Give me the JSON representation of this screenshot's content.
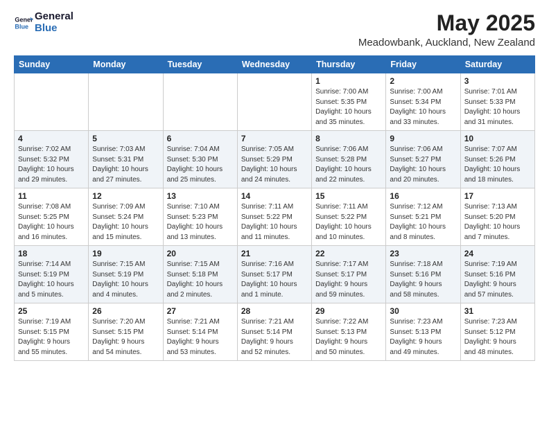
{
  "header": {
    "logo_line1": "General",
    "logo_line2": "Blue",
    "month_title": "May 2025",
    "location": "Meadowbank, Auckland, New Zealand"
  },
  "weekdays": [
    "Sunday",
    "Monday",
    "Tuesday",
    "Wednesday",
    "Thursday",
    "Friday",
    "Saturday"
  ],
  "weeks": [
    [
      {
        "day": "",
        "content": ""
      },
      {
        "day": "",
        "content": ""
      },
      {
        "day": "",
        "content": ""
      },
      {
        "day": "",
        "content": ""
      },
      {
        "day": "1",
        "content": "Sunrise: 7:00 AM\nSunset: 5:35 PM\nDaylight: 10 hours\nand 35 minutes."
      },
      {
        "day": "2",
        "content": "Sunrise: 7:00 AM\nSunset: 5:34 PM\nDaylight: 10 hours\nand 33 minutes."
      },
      {
        "day": "3",
        "content": "Sunrise: 7:01 AM\nSunset: 5:33 PM\nDaylight: 10 hours\nand 31 minutes."
      }
    ],
    [
      {
        "day": "4",
        "content": "Sunrise: 7:02 AM\nSunset: 5:32 PM\nDaylight: 10 hours\nand 29 minutes."
      },
      {
        "day": "5",
        "content": "Sunrise: 7:03 AM\nSunset: 5:31 PM\nDaylight: 10 hours\nand 27 minutes."
      },
      {
        "day": "6",
        "content": "Sunrise: 7:04 AM\nSunset: 5:30 PM\nDaylight: 10 hours\nand 25 minutes."
      },
      {
        "day": "7",
        "content": "Sunrise: 7:05 AM\nSunset: 5:29 PM\nDaylight: 10 hours\nand 24 minutes."
      },
      {
        "day": "8",
        "content": "Sunrise: 7:06 AM\nSunset: 5:28 PM\nDaylight: 10 hours\nand 22 minutes."
      },
      {
        "day": "9",
        "content": "Sunrise: 7:06 AM\nSunset: 5:27 PM\nDaylight: 10 hours\nand 20 minutes."
      },
      {
        "day": "10",
        "content": "Sunrise: 7:07 AM\nSunset: 5:26 PM\nDaylight: 10 hours\nand 18 minutes."
      }
    ],
    [
      {
        "day": "11",
        "content": "Sunrise: 7:08 AM\nSunset: 5:25 PM\nDaylight: 10 hours\nand 16 minutes."
      },
      {
        "day": "12",
        "content": "Sunrise: 7:09 AM\nSunset: 5:24 PM\nDaylight: 10 hours\nand 15 minutes."
      },
      {
        "day": "13",
        "content": "Sunrise: 7:10 AM\nSunset: 5:23 PM\nDaylight: 10 hours\nand 13 minutes."
      },
      {
        "day": "14",
        "content": "Sunrise: 7:11 AM\nSunset: 5:22 PM\nDaylight: 10 hours\nand 11 minutes."
      },
      {
        "day": "15",
        "content": "Sunrise: 7:11 AM\nSunset: 5:22 PM\nDaylight: 10 hours\nand 10 minutes."
      },
      {
        "day": "16",
        "content": "Sunrise: 7:12 AM\nSunset: 5:21 PM\nDaylight: 10 hours\nand 8 minutes."
      },
      {
        "day": "17",
        "content": "Sunrise: 7:13 AM\nSunset: 5:20 PM\nDaylight: 10 hours\nand 7 minutes."
      }
    ],
    [
      {
        "day": "18",
        "content": "Sunrise: 7:14 AM\nSunset: 5:19 PM\nDaylight: 10 hours\nand 5 minutes."
      },
      {
        "day": "19",
        "content": "Sunrise: 7:15 AM\nSunset: 5:19 PM\nDaylight: 10 hours\nand 4 minutes."
      },
      {
        "day": "20",
        "content": "Sunrise: 7:15 AM\nSunset: 5:18 PM\nDaylight: 10 hours\nand 2 minutes."
      },
      {
        "day": "21",
        "content": "Sunrise: 7:16 AM\nSunset: 5:17 PM\nDaylight: 10 hours\nand 1 minute."
      },
      {
        "day": "22",
        "content": "Sunrise: 7:17 AM\nSunset: 5:17 PM\nDaylight: 9 hours\nand 59 minutes."
      },
      {
        "day": "23",
        "content": "Sunrise: 7:18 AM\nSunset: 5:16 PM\nDaylight: 9 hours\nand 58 minutes."
      },
      {
        "day": "24",
        "content": "Sunrise: 7:19 AM\nSunset: 5:16 PM\nDaylight: 9 hours\nand 57 minutes."
      }
    ],
    [
      {
        "day": "25",
        "content": "Sunrise: 7:19 AM\nSunset: 5:15 PM\nDaylight: 9 hours\nand 55 minutes."
      },
      {
        "day": "26",
        "content": "Sunrise: 7:20 AM\nSunset: 5:15 PM\nDaylight: 9 hours\nand 54 minutes."
      },
      {
        "day": "27",
        "content": "Sunrise: 7:21 AM\nSunset: 5:14 PM\nDaylight: 9 hours\nand 53 minutes."
      },
      {
        "day": "28",
        "content": "Sunrise: 7:21 AM\nSunset: 5:14 PM\nDaylight: 9 hours\nand 52 minutes."
      },
      {
        "day": "29",
        "content": "Sunrise: 7:22 AM\nSunset: 5:13 PM\nDaylight: 9 hours\nand 50 minutes."
      },
      {
        "day": "30",
        "content": "Sunrise: 7:23 AM\nSunset: 5:13 PM\nDaylight: 9 hours\nand 49 minutes."
      },
      {
        "day": "31",
        "content": "Sunrise: 7:23 AM\nSunset: 5:12 PM\nDaylight: 9 hours\nand 48 minutes."
      }
    ]
  ]
}
